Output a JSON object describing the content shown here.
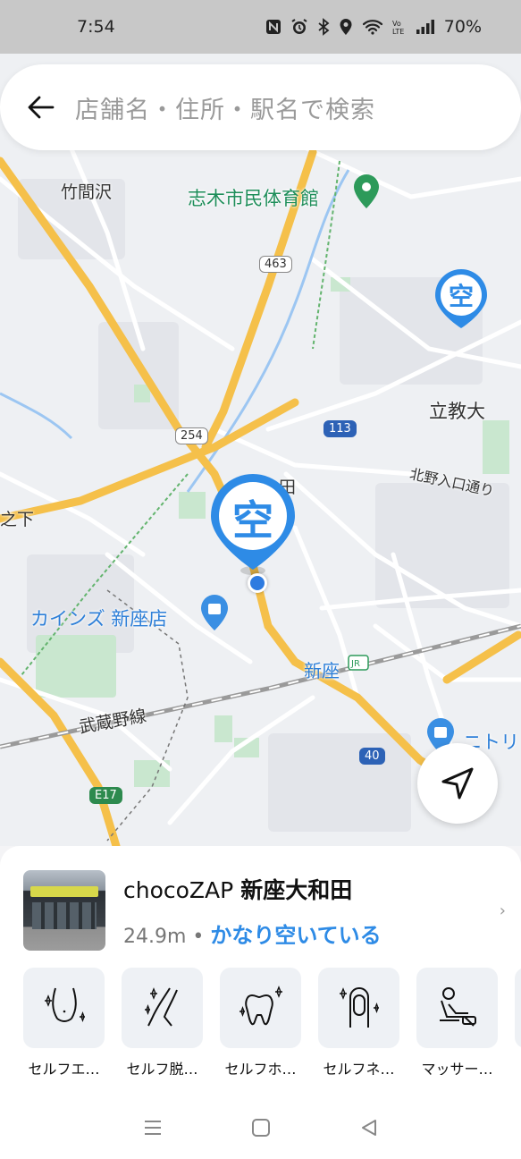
{
  "status_bar": {
    "time": "7:54",
    "battery": "70%",
    "icons": [
      "nfc-icon",
      "alarm-icon",
      "bluetooth-icon",
      "location-icon",
      "wifi-icon",
      "volte-icon",
      "signal-icon"
    ]
  },
  "search": {
    "placeholder": "店舗名・住所・駅名で検索"
  },
  "map": {
    "labels": {
      "takemazawa": "竹間沢",
      "shiki_gym": "志木市民体育館",
      "rikkyo": "立教大",
      "kitano_iriguchi": "北野入口通り",
      "cainz": "カインズ 新座店",
      "niiza_station": "新座",
      "musashino_line": "武蔵野線",
      "nitori": "ニトリ",
      "no_shita": "之下",
      "den": "田"
    },
    "routes": {
      "r463": "463",
      "r254": "254",
      "r113": "113",
      "r40": "40",
      "e17": "E17"
    },
    "pin_char": "空"
  },
  "store": {
    "brand": "chocoZAP",
    "branch": "新座大和田",
    "distance": "24.9m",
    "separator": "•",
    "status": "かなり空いている"
  },
  "services": [
    {
      "label": "セルフエ…",
      "icon": "waist-sparkle-icon"
    },
    {
      "label": "セルフ脱…",
      "icon": "leg-sparkle-icon"
    },
    {
      "label": "セルフホ…",
      "icon": "tooth-sparkle-icon"
    },
    {
      "label": "セルフネ…",
      "icon": "nail-sparkle-icon"
    },
    {
      "label": "マッサー…",
      "icon": "massage-chair-icon"
    }
  ],
  "colors": {
    "accent": "#2e8be6",
    "highway": "#f5c04a",
    "map_bg": "#eef0f3"
  }
}
